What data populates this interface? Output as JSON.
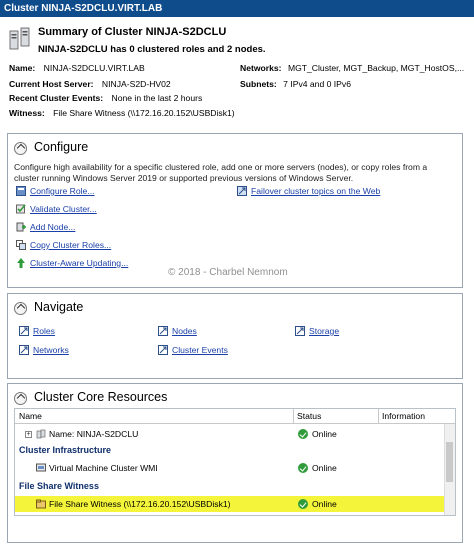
{
  "window": {
    "title": "Cluster NINJA-S2DCLU.VIRT.LAB"
  },
  "summary": {
    "title": "Summary of Cluster NINJA-S2DCLU",
    "subtitle": "NINJA-S2DCLU has 0 clustered roles and 2 nodes.",
    "name_label": "Name:",
    "name_value": "NINJA-S2DCLU.VIRT.LAB",
    "host_label": "Current Host Server:",
    "host_value": "NINJA-S2D-HV02",
    "events_label": "Recent Cluster Events:",
    "events_value": "None in the last 2 hours",
    "witness_label": "Witness:",
    "witness_value": "File Share Witness (\\\\172.16.20.152\\USBDisk1)",
    "networks_label": "Networks:",
    "networks_value": "MGT_Cluster, MGT_Backup, MGT_HostOS,...",
    "subnets_label": "Subnets:",
    "subnets_value": "7 IPv4 and 0 IPv6"
  },
  "configure": {
    "heading": "Configure",
    "description": "Configure high availability for a specific clustered role, add one or more servers (nodes), or copy roles from a cluster running Windows Server 2019 or supported previous versions of Windows Server.",
    "links": [
      "Configure Role...",
      "Validate Cluster...",
      "Add Node...",
      "Copy Cluster Roles...",
      "Cluster-Aware Updating..."
    ],
    "topics_link": "Failover cluster topics on the Web"
  },
  "watermark": "© 2018 - Charbel Nemnom",
  "navigate": {
    "heading": "Navigate",
    "links": [
      "Roles",
      "Nodes",
      "Storage",
      "Networks",
      "Cluster Events"
    ]
  },
  "core": {
    "heading": "Cluster Core Resources",
    "columns": [
      "Name",
      "Status",
      "Information"
    ],
    "name_row": {
      "name": "Name: NINJA-S2DCLU",
      "status": "Online"
    },
    "group_infra": "Cluster Infrastructure",
    "infra_row": {
      "name": "Virtual Machine Cluster WMI",
      "status": "Online"
    },
    "group_witness": "File Share Witness",
    "witness_row": {
      "name": "File Share Witness (\\\\172.16.20.152\\USBDisk1)",
      "status": "Online"
    }
  },
  "colors": {
    "titlebar": "#0f4c8c",
    "link": "#1a3fa8",
    "highlight": "#f4f53a",
    "online": "#2f9b3a"
  }
}
